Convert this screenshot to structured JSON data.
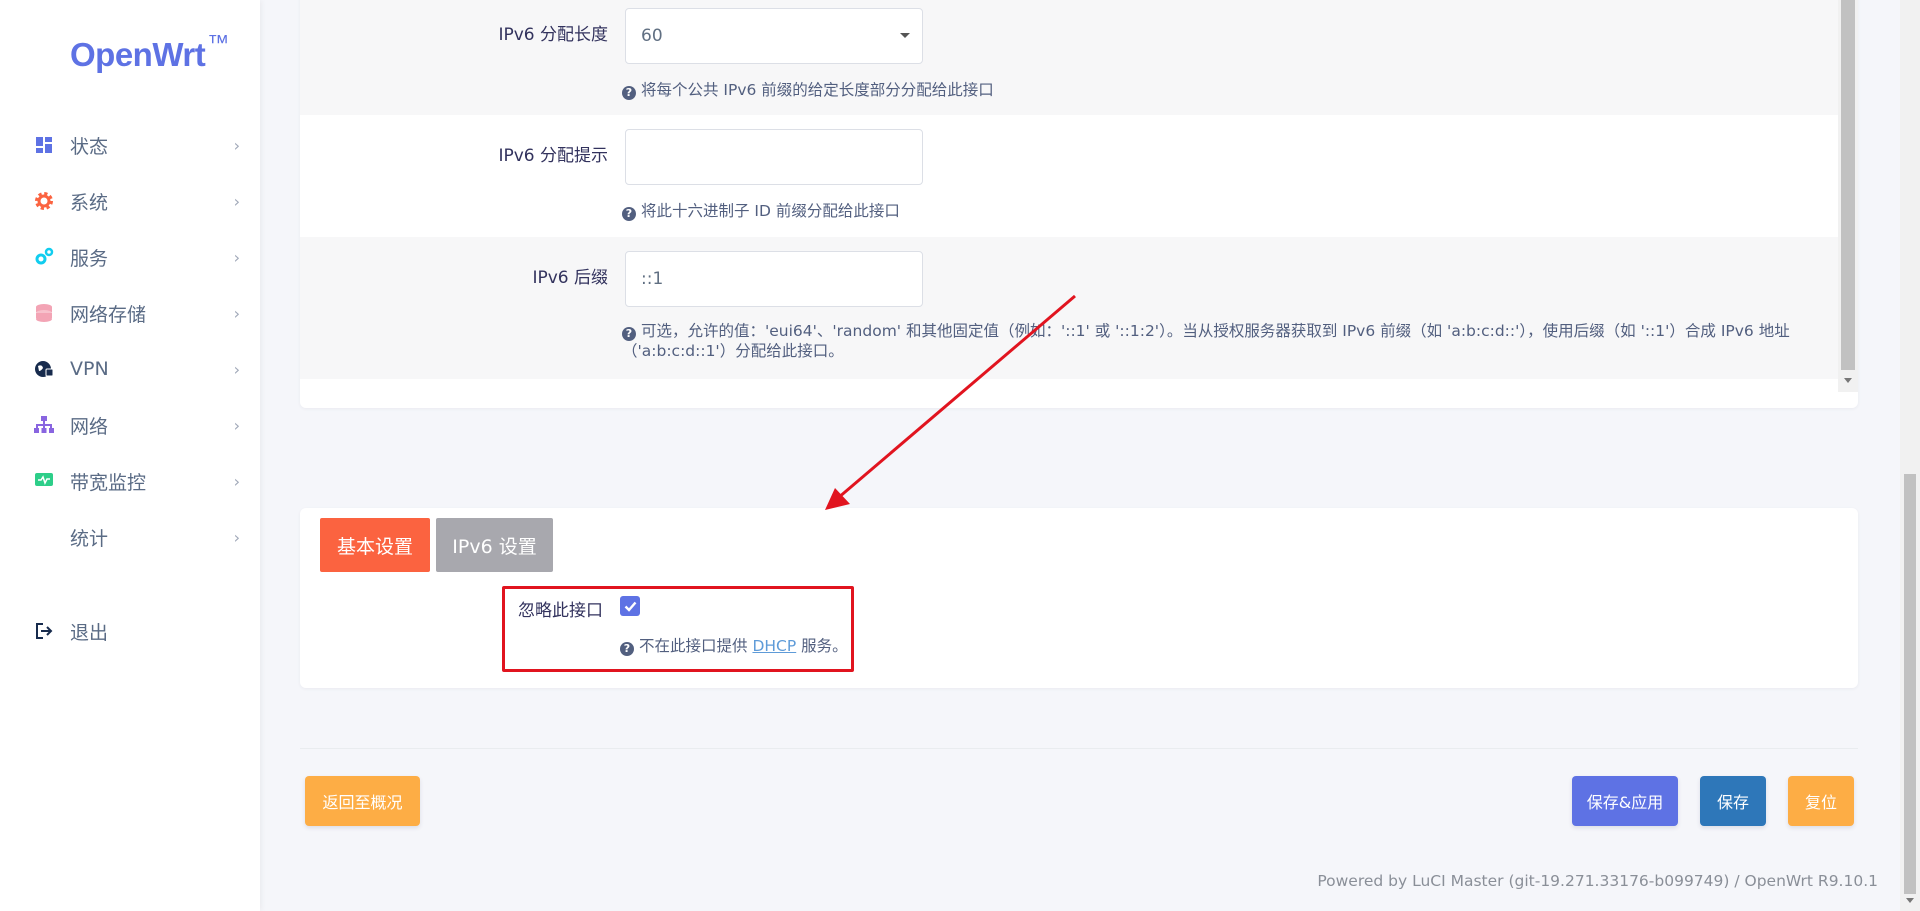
{
  "brand": {
    "name": "OpenWrt",
    "tm": "™"
  },
  "sidebar": {
    "items": [
      {
        "label": "状态",
        "icon": "dashboard-icon",
        "color": "#5e72e4"
      },
      {
        "label": "系统",
        "icon": "gear-icon",
        "color": "#fb6340"
      },
      {
        "label": "服务",
        "icon": "cogs-icon",
        "color": "#11cdef"
      },
      {
        "label": "网络存储",
        "icon": "database-icon",
        "color": "#f3a4b5"
      },
      {
        "label": "VPN",
        "icon": "globe-lock-icon",
        "color": "#172b4d"
      },
      {
        "label": "网络",
        "icon": "sitemap-icon",
        "color": "#8965e0"
      },
      {
        "label": "带宽监控",
        "icon": "monitor-icon",
        "color": "#2dce89"
      },
      {
        "label": "统计",
        "icon": "",
        "color": ""
      }
    ],
    "logout": {
      "label": "退出",
      "icon": "sign-out-icon"
    }
  },
  "ipv6_section": {
    "assign_length": {
      "label": "IPv6 分配长度",
      "value": "60",
      "hint": "将每个公共 IPv6 前缀的给定长度部分分配给此接口"
    },
    "assign_hint": {
      "label": "IPv6 分配提示",
      "value": "",
      "hint": "将此十六进制子 ID 前缀分配给此接口"
    },
    "suffix": {
      "label": "IPv6 后缀",
      "value": "::1",
      "hint_line1": "可选，允许的值：'eui64'、'random' 和其他固定值（例如：'::1' 或 '::1:2'）。当从授权服务器获取到 IPv6 前缀（如 'a:b:c:d::'），使用后缀（如 '::1'）合成 IPv6 地址",
      "hint_line2": "（'a:b:c:d::1'）分配给此接口。"
    }
  },
  "dhcp_section": {
    "tabs": [
      {
        "label": "基本设置"
      },
      {
        "label": "IPv6 设置"
      }
    ],
    "ignore": {
      "label": "忽略此接口",
      "checked": true,
      "hint_prefix": "不在此接口提供",
      "hint_link": "DHCP",
      "hint_suffix": "服务。"
    }
  },
  "actions": {
    "back": "返回至概况",
    "save_apply": "保存&应用",
    "save": "保存",
    "reset": "复位"
  },
  "footer": "Powered by LuCI Master (git-19.271.33176-b099749) / OpenWrt R9.10.1",
  "colors": {
    "accent": "#5e72e4",
    "orange": "#fb6340",
    "warning": "#fdad45",
    "info": "#2e77b9",
    "annotation": "#e1141f"
  }
}
